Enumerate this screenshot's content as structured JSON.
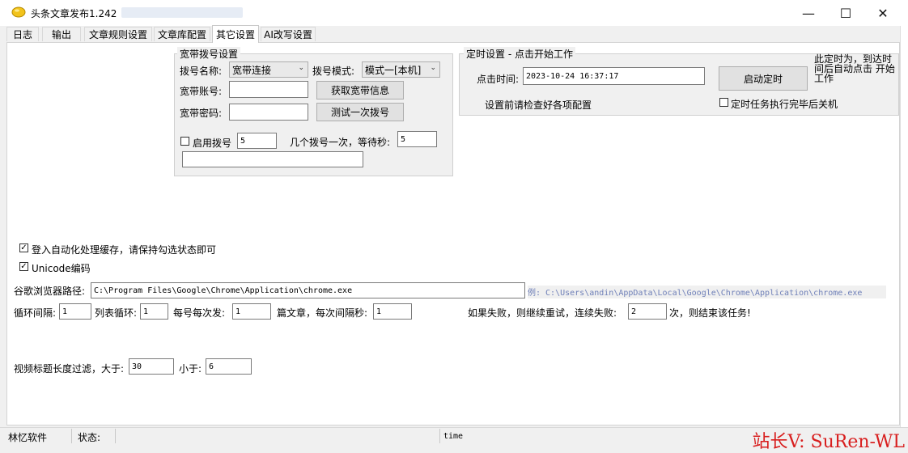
{
  "window": {
    "title": "头条文章发布1.242",
    "controls": {
      "minimize": "—",
      "maximize": "☐",
      "close": "✕"
    }
  },
  "tabs": [
    "日志",
    "输出",
    "文章规则设置",
    "文章库配置",
    "其它设置",
    "AI改写设置"
  ],
  "active_tab": "其它设置",
  "dial_group": {
    "legend": "宽带拨号设置",
    "name_label": "拨号名称:",
    "name_value": "宽带连接",
    "mode_label": "拨号模式:",
    "mode_value": "模式一[本机]",
    "account_label": "宽带账号:",
    "account_value": "",
    "get_info_button": "获取宽带信息",
    "password_label": "宽带密码:",
    "password_value": "",
    "test_button": "测试一次拨号",
    "enable_label": "启用拨号",
    "enable_checked": false,
    "dial_count_value": "5",
    "wait_label": "几个拨号一次，等待秒:",
    "wait_value": "5",
    "status_value": ""
  },
  "timer_group": {
    "legend": "定时设置 - 点击开始工作",
    "time_label": "点击时间:",
    "time_value": "2023-10-24 16:37:17",
    "start_button": "启动定时",
    "hint": "设置前请检查好各项配置",
    "note": "此定时为，到达时间后自动点击 开始工作",
    "shutdown_label": "定时任务执行完毕后关机",
    "shutdown_checked": false
  },
  "options": {
    "cache_label": "登入自动化处理缓存，请保持勾选状态即可",
    "cache_checked": true,
    "unicode_label": "Unicode编码",
    "unicode_checked": true,
    "chrome_label": "谷歌浏览器路径:",
    "chrome_value": "C:\\Program Files\\Google\\Chrome\\Application\\chrome.exe",
    "chrome_example": "例: C:\\Users\\andin\\AppData\\Local\\Google\\Chrome\\Application\\chrome.exe",
    "loop_interval_label": "循环间隔:",
    "loop_interval_value": "1",
    "list_loop_label": "列表循环:",
    "list_loop_value": "1",
    "per_account_label": "每号每次发:",
    "per_account_value": "1",
    "article_interval_label": "篇文章，每次间隔秒:",
    "article_interval_value": "1",
    "retry_label": "如果失败，则继续重试，连续失败:",
    "retry_value": "2",
    "retry_suffix": "次，则结束该任务!",
    "title_filter_label": "视频标题长度过滤，大于:",
    "title_min_value": "30",
    "title_max_label": "小于:",
    "title_max_value": "6"
  },
  "statusbar": {
    "company": "林忆软件",
    "status_label": "状态:",
    "time_label": "time"
  },
  "watermark": "站长V: SuRen-WL",
  "colors": {
    "example_text": "#6e7fb8",
    "watermark": "#d81e1e"
  }
}
